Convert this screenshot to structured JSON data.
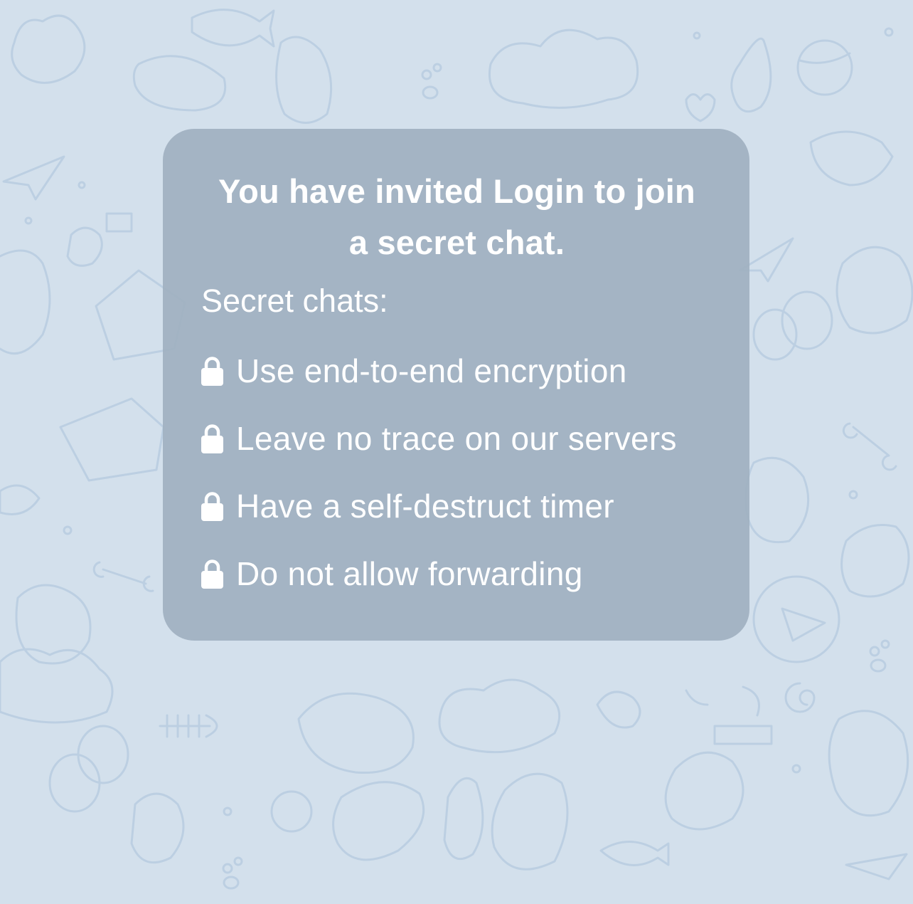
{
  "colors": {
    "background": "#d3e0ec",
    "pattern_stroke": "#bccfe2",
    "card": "#a0b0c1",
    "text": "#ffffff"
  },
  "secret_chat_card": {
    "title": "You have invited Login to join a secret chat.",
    "subtitle": "Secret chats:",
    "features": [
      {
        "icon": "lock-icon",
        "label": "Use end-to-end encryption"
      },
      {
        "icon": "lock-icon",
        "label": "Leave no trace on our servers"
      },
      {
        "icon": "lock-icon",
        "label": "Have a self-destruct timer"
      },
      {
        "icon": "lock-icon",
        "label": "Do not allow forwarding"
      }
    ]
  }
}
